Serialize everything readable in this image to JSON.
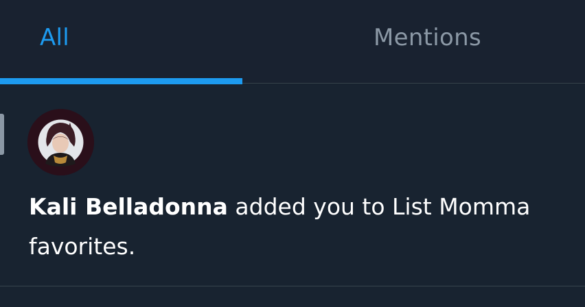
{
  "tabs": [
    {
      "label": "All",
      "active": true
    },
    {
      "label": "Mentions",
      "active": false
    }
  ],
  "colors": {
    "background": "#15202b",
    "accent": "#1d9bf0",
    "muted": "#8b98a5",
    "divider": "#38444d"
  },
  "notification": {
    "actor": "Kali Belladonna",
    "message": " added you to List Momma favorites.",
    "avatar_icon": "user-avatar"
  }
}
